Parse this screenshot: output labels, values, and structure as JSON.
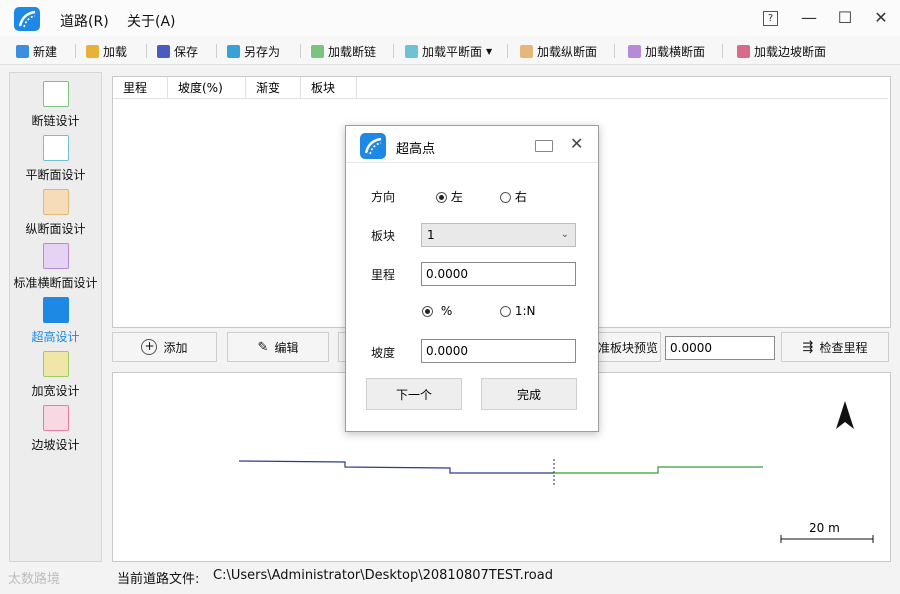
{
  "menu": {
    "road": "道路(R)",
    "about": "关于(A)"
  },
  "window_controls": {
    "help": "?",
    "minimize": "—",
    "maximize": "☐",
    "close": "✕"
  },
  "toolbar": {
    "new": "新建",
    "load": "加载",
    "save": "保存",
    "save_as": "另存为",
    "load_chain": "加载断链",
    "load_plan": "加载平断面",
    "load_profile": "加载纵断面",
    "load_cross": "加载横断面",
    "load_slope": "加载边坡断面"
  },
  "sidebar": {
    "items": [
      {
        "label": "断链设计",
        "icon": "chain-icon"
      },
      {
        "label": "平断面设计",
        "icon": "plan-icon"
      },
      {
        "label": "纵断面设计",
        "icon": "profile-icon"
      },
      {
        "label": "标准横断面设计",
        "icon": "cross-section-icon"
      },
      {
        "label": "超高设计",
        "icon": "superelevation-icon"
      },
      {
        "label": "加宽设计",
        "icon": "widening-icon"
      },
      {
        "label": "边坡设计",
        "icon": "slope-icon"
      }
    ],
    "active": "超高设计"
  },
  "table": {
    "columns": [
      "里程",
      "坡度(%)",
      "渐变",
      "板块"
    ]
  },
  "actions": {
    "add": "添加",
    "edit": "编辑",
    "block_preview": "准板块预览",
    "preview_value": "0.0000",
    "check_mileage": "检查里程"
  },
  "canvas": {
    "scale_label": "20 m",
    "north": "N"
  },
  "dialog": {
    "title": "超高点",
    "direction_label": "方向",
    "left": "左",
    "right": "右",
    "direction_selected": "左",
    "block_label": "板块",
    "block_value": "1",
    "mileage_label": "里程",
    "mileage_value": "0.0000",
    "percent": "%",
    "ratio": "1:N",
    "unit_selected": "%",
    "slope_label": "坡度",
    "slope_value": "0.0000",
    "next": "下一个",
    "finish": "完成"
  },
  "status": {
    "label": "当前道路文件:",
    "path": "C:\\Users\\Administrator\\Desktop\\20810807TEST.road"
  },
  "watermark": "太数路境",
  "colors": {
    "accent": "#1e88e5",
    "line_blue": "#2b3a8f",
    "line_green": "#3a9a3a"
  }
}
